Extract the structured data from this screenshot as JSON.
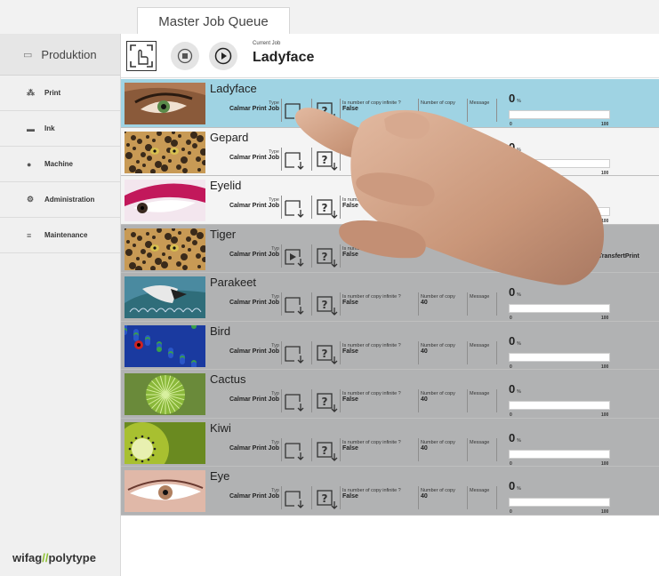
{
  "tab": {
    "label": "Master Job Queue"
  },
  "sidebar": {
    "main": {
      "label": "Produktion",
      "icon": "window-icon"
    },
    "items": [
      {
        "label": "Print",
        "icon": "print-dots-icon"
      },
      {
        "label": "Ink",
        "icon": "ink-icon"
      },
      {
        "label": "Machine",
        "icon": "machine-icon"
      },
      {
        "label": "Administration",
        "icon": "admin-icon"
      },
      {
        "label": "Maintenance",
        "icon": "maintenance-icon"
      }
    ],
    "logo": {
      "part1": "wifag",
      "slash": "//",
      "part2": "polytype"
    }
  },
  "header": {
    "current_label": "Current Job",
    "current_name": "Ladyface"
  },
  "jobs": [
    {
      "name": "Ladyface",
      "type_label": "Type",
      "type": "Calmar Print Job",
      "infinite_label": "Is number of copy infinite ?",
      "infinite": "False",
      "copies_label": "Number of copy",
      "copies": "",
      "message_label": "Message",
      "progress": 0,
      "state": "active"
    },
    {
      "name": "Gepard",
      "type_label": "Type",
      "type": "Calmar Print Job",
      "infinite_label": "",
      "infinite": "False",
      "copies_label": "",
      "copies": "",
      "message_label": "",
      "progress": 0,
      "state": "light"
    },
    {
      "name": "Eyelid",
      "type_label": "Type",
      "type": "Calmar Print Job",
      "infinite_label": "Is number of copy infinite",
      "infinite": "False",
      "copies_label": "",
      "copies": "",
      "message_label": "",
      "progress": 0,
      "state": "light"
    },
    {
      "name": "Tiger",
      "type_label": "Typ",
      "type": "Calmar Print Job",
      "infinite_label": "Is number of co",
      "infinite": "False",
      "copies_label": "",
      "copies": "",
      "message_label": "",
      "extra": "narTransfertPrint",
      "progress": null,
      "state": "grey"
    },
    {
      "name": "Parakeet",
      "type_label": "Typ",
      "type": "Calmar Print Job",
      "infinite_label": "Is number of copy infinite ?",
      "infinite": "False",
      "copies_label": "Number of copy",
      "copies": "40",
      "message_label": "Message",
      "progress": 0,
      "state": "grey"
    },
    {
      "name": "Bird",
      "type_label": "Typ",
      "type": "Calmar Print Job",
      "infinite_label": "Is number of copy infinite ?",
      "infinite": "False",
      "copies_label": "Number of copy",
      "copies": "40",
      "message_label": "Message",
      "progress": 0,
      "state": "grey"
    },
    {
      "name": "Cactus",
      "type_label": "Typ",
      "type": "Calmar Print Job",
      "infinite_label": "Is number of copy infinite ?",
      "infinite": "False",
      "copies_label": "Number of copy",
      "copies": "40",
      "message_label": "Message",
      "progress": 0,
      "state": "grey"
    },
    {
      "name": "Kiwi",
      "type_label": "Typ",
      "type": "Calmar Print Job",
      "infinite_label": "Is number of copy infinite ?",
      "infinite": "False",
      "copies_label": "Number of copy",
      "copies": "40",
      "message_label": "Message",
      "progress": 0,
      "state": "grey"
    },
    {
      "name": "Eye",
      "type_label": "Typ",
      "type": "Calmar Print Job",
      "infinite_label": "Is number of copy infinite ?",
      "infinite": "False",
      "copies_label": "Number of copy",
      "copies": "40",
      "message_label": "Message",
      "progress": 0,
      "state": "grey"
    }
  ],
  "progress_scale": {
    "min": "0",
    "max": "100",
    "unit": "%"
  }
}
